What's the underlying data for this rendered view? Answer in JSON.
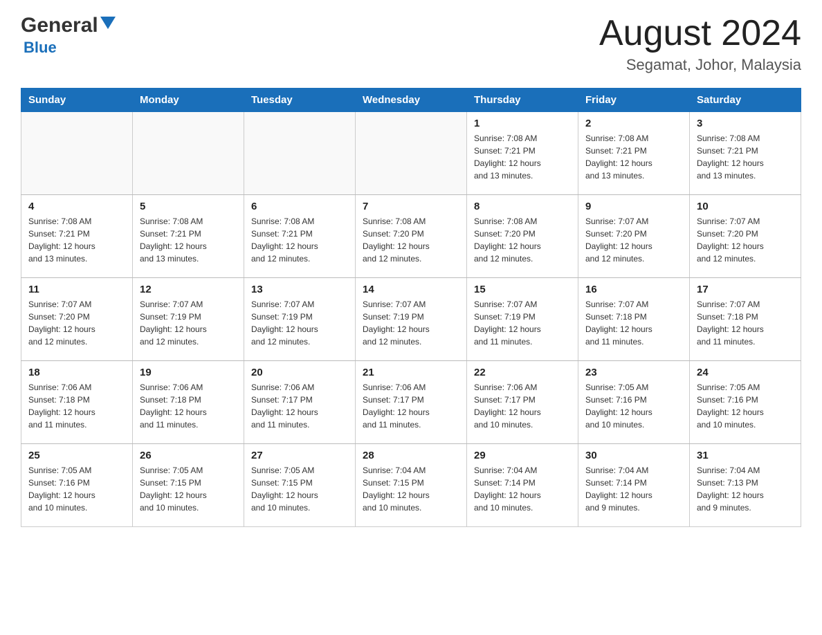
{
  "header": {
    "logo_general": "General",
    "logo_blue": "Blue",
    "title": "August 2024",
    "subtitle": "Segamat, Johor, Malaysia"
  },
  "days_of_week": [
    "Sunday",
    "Monday",
    "Tuesday",
    "Wednesday",
    "Thursday",
    "Friday",
    "Saturday"
  ],
  "weeks": [
    [
      {
        "day": "",
        "info": ""
      },
      {
        "day": "",
        "info": ""
      },
      {
        "day": "",
        "info": ""
      },
      {
        "day": "",
        "info": ""
      },
      {
        "day": "1",
        "info": "Sunrise: 7:08 AM\nSunset: 7:21 PM\nDaylight: 12 hours\nand 13 minutes."
      },
      {
        "day": "2",
        "info": "Sunrise: 7:08 AM\nSunset: 7:21 PM\nDaylight: 12 hours\nand 13 minutes."
      },
      {
        "day": "3",
        "info": "Sunrise: 7:08 AM\nSunset: 7:21 PM\nDaylight: 12 hours\nand 13 minutes."
      }
    ],
    [
      {
        "day": "4",
        "info": "Sunrise: 7:08 AM\nSunset: 7:21 PM\nDaylight: 12 hours\nand 13 minutes."
      },
      {
        "day": "5",
        "info": "Sunrise: 7:08 AM\nSunset: 7:21 PM\nDaylight: 12 hours\nand 13 minutes."
      },
      {
        "day": "6",
        "info": "Sunrise: 7:08 AM\nSunset: 7:21 PM\nDaylight: 12 hours\nand 12 minutes."
      },
      {
        "day": "7",
        "info": "Sunrise: 7:08 AM\nSunset: 7:20 PM\nDaylight: 12 hours\nand 12 minutes."
      },
      {
        "day": "8",
        "info": "Sunrise: 7:08 AM\nSunset: 7:20 PM\nDaylight: 12 hours\nand 12 minutes."
      },
      {
        "day": "9",
        "info": "Sunrise: 7:07 AM\nSunset: 7:20 PM\nDaylight: 12 hours\nand 12 minutes."
      },
      {
        "day": "10",
        "info": "Sunrise: 7:07 AM\nSunset: 7:20 PM\nDaylight: 12 hours\nand 12 minutes."
      }
    ],
    [
      {
        "day": "11",
        "info": "Sunrise: 7:07 AM\nSunset: 7:20 PM\nDaylight: 12 hours\nand 12 minutes."
      },
      {
        "day": "12",
        "info": "Sunrise: 7:07 AM\nSunset: 7:19 PM\nDaylight: 12 hours\nand 12 minutes."
      },
      {
        "day": "13",
        "info": "Sunrise: 7:07 AM\nSunset: 7:19 PM\nDaylight: 12 hours\nand 12 minutes."
      },
      {
        "day": "14",
        "info": "Sunrise: 7:07 AM\nSunset: 7:19 PM\nDaylight: 12 hours\nand 12 minutes."
      },
      {
        "day": "15",
        "info": "Sunrise: 7:07 AM\nSunset: 7:19 PM\nDaylight: 12 hours\nand 11 minutes."
      },
      {
        "day": "16",
        "info": "Sunrise: 7:07 AM\nSunset: 7:18 PM\nDaylight: 12 hours\nand 11 minutes."
      },
      {
        "day": "17",
        "info": "Sunrise: 7:07 AM\nSunset: 7:18 PM\nDaylight: 12 hours\nand 11 minutes."
      }
    ],
    [
      {
        "day": "18",
        "info": "Sunrise: 7:06 AM\nSunset: 7:18 PM\nDaylight: 12 hours\nand 11 minutes."
      },
      {
        "day": "19",
        "info": "Sunrise: 7:06 AM\nSunset: 7:18 PM\nDaylight: 12 hours\nand 11 minutes."
      },
      {
        "day": "20",
        "info": "Sunrise: 7:06 AM\nSunset: 7:17 PM\nDaylight: 12 hours\nand 11 minutes."
      },
      {
        "day": "21",
        "info": "Sunrise: 7:06 AM\nSunset: 7:17 PM\nDaylight: 12 hours\nand 11 minutes."
      },
      {
        "day": "22",
        "info": "Sunrise: 7:06 AM\nSunset: 7:17 PM\nDaylight: 12 hours\nand 10 minutes."
      },
      {
        "day": "23",
        "info": "Sunrise: 7:05 AM\nSunset: 7:16 PM\nDaylight: 12 hours\nand 10 minutes."
      },
      {
        "day": "24",
        "info": "Sunrise: 7:05 AM\nSunset: 7:16 PM\nDaylight: 12 hours\nand 10 minutes."
      }
    ],
    [
      {
        "day": "25",
        "info": "Sunrise: 7:05 AM\nSunset: 7:16 PM\nDaylight: 12 hours\nand 10 minutes."
      },
      {
        "day": "26",
        "info": "Sunrise: 7:05 AM\nSunset: 7:15 PM\nDaylight: 12 hours\nand 10 minutes."
      },
      {
        "day": "27",
        "info": "Sunrise: 7:05 AM\nSunset: 7:15 PM\nDaylight: 12 hours\nand 10 minutes."
      },
      {
        "day": "28",
        "info": "Sunrise: 7:04 AM\nSunset: 7:15 PM\nDaylight: 12 hours\nand 10 minutes."
      },
      {
        "day": "29",
        "info": "Sunrise: 7:04 AM\nSunset: 7:14 PM\nDaylight: 12 hours\nand 10 minutes."
      },
      {
        "day": "30",
        "info": "Sunrise: 7:04 AM\nSunset: 7:14 PM\nDaylight: 12 hours\nand 9 minutes."
      },
      {
        "day": "31",
        "info": "Sunrise: 7:04 AM\nSunset: 7:13 PM\nDaylight: 12 hours\nand 9 minutes."
      }
    ]
  ]
}
